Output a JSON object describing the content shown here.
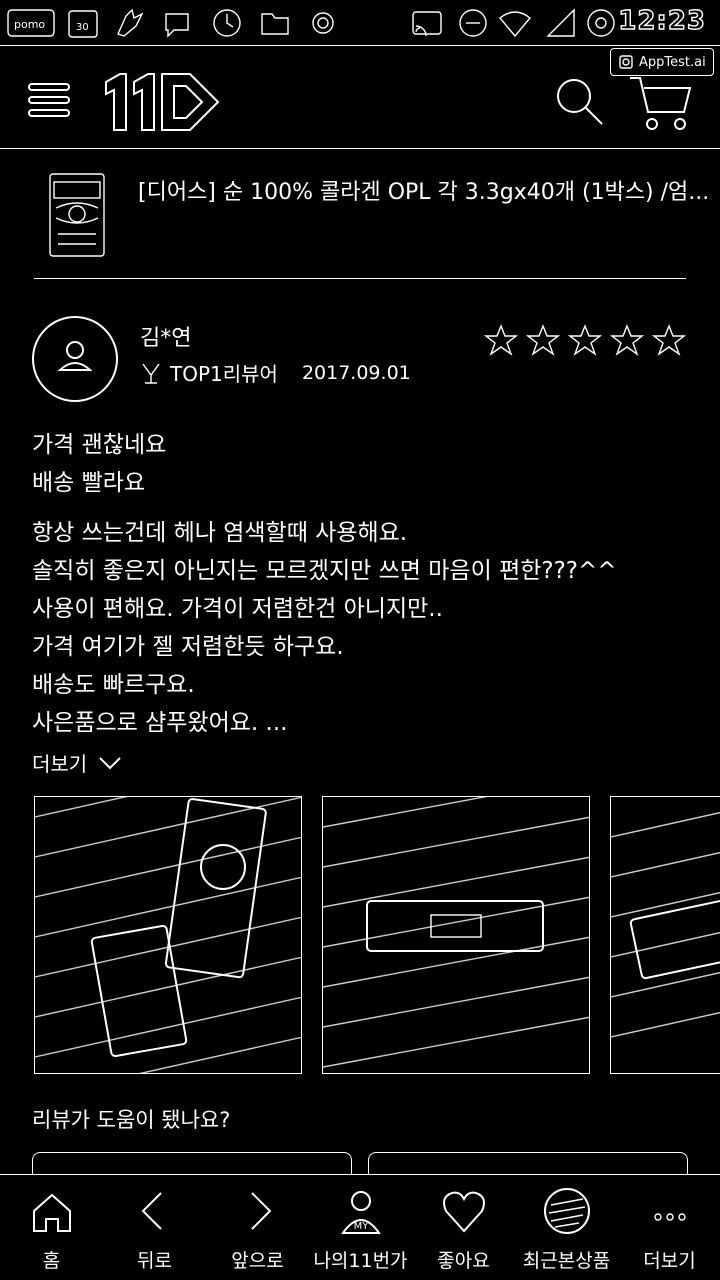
{
  "status_bar": {
    "time": "12:23",
    "left_icons": [
      "pomo-icon",
      "calendar-icon",
      "bird-icon",
      "chat-icon",
      "clock-icon",
      "folder-icon",
      "circle-icon"
    ],
    "right_icons": [
      "cast-icon",
      "minus-circle-icon",
      "wifi-icon",
      "signal-icon",
      "alarm-icon"
    ],
    "calendar_day": "30"
  },
  "watermark": {
    "label": "AppTest.ai"
  },
  "header": {
    "logo": "11",
    "menu_icon": "menu-icon",
    "search_icon": "search-icon",
    "cart_icon": "cart-icon"
  },
  "product": {
    "title": "[디어스] 순 100% 콜라겐 OPL 각 3.3gx40개 (1박스) /엄..."
  },
  "review": {
    "reviewer": "김*연",
    "badge": "TOP1리뷰어",
    "date": "2017.09.01",
    "rating": 5,
    "paragraphs": [
      [
        "가격 괜찮네요",
        "배송 빨라요"
      ],
      [
        "항상 쓰는건데 헤나 염색할때 사용해요.",
        "솔직히 좋은지 아닌지는 모르겠지만 쓰면 마음이 편한???^^",
        "사용이 편해요. 가격이 저렴한건 아니지만..",
        "가격 여기가 젤 저렴한듯 하구요.",
        "배송도 빠르구요.",
        "사은품으로 샴푸왔어요. ..."
      ]
    ],
    "more": "더보기"
  },
  "helpful": {
    "question": "리뷰가 도움이 됐나요?"
  },
  "bottom_nav": {
    "items": [
      {
        "label": "홈",
        "icon": "home-icon"
      },
      {
        "label": "뒤로",
        "icon": "back-icon"
      },
      {
        "label": "앞으로",
        "icon": "forward-icon"
      },
      {
        "label": "나의11번가",
        "icon": "my-icon",
        "icon_text": "MY"
      },
      {
        "label": "좋아요",
        "icon": "heart-icon"
      },
      {
        "label": "최근본상품",
        "icon": "recent-product-icon"
      },
      {
        "label": "더보기",
        "icon": "more-icon"
      }
    ]
  }
}
